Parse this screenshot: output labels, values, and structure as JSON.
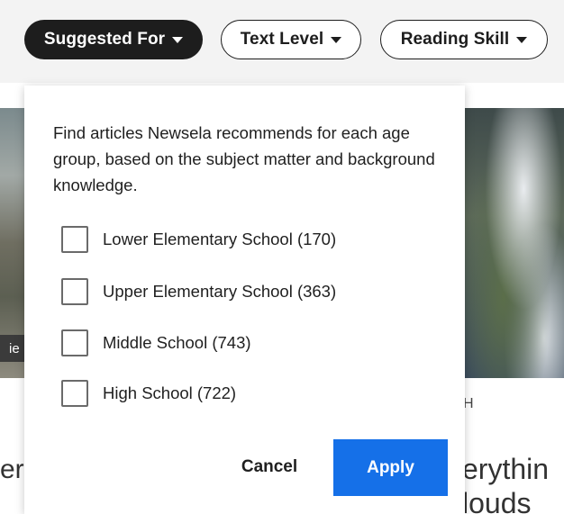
{
  "filters": {
    "suggested_for": "Suggested For",
    "text_level": "Text Level",
    "reading_skill": "Reading Skill"
  },
  "background": {
    "left_tag": "ie",
    "right_letter": "H",
    "left_text": "er",
    "right_text_line1": "verythin",
    "right_text_line2": "clouds"
  },
  "popover": {
    "description": "Find articles Newsela recommends for each age group, based on the subject matter and background knowledge.",
    "options": [
      {
        "label": "Lower Elementary School (170)",
        "checked": false
      },
      {
        "label": "Upper Elementary School (363)",
        "checked": false
      },
      {
        "label": "Middle School (743)",
        "checked": false
      },
      {
        "label": "High School (722)",
        "checked": false
      }
    ],
    "cancel_label": "Cancel",
    "apply_label": "Apply"
  },
  "colors": {
    "apply_button": "#1570e8",
    "active_pill": "#1d1d1d"
  }
}
